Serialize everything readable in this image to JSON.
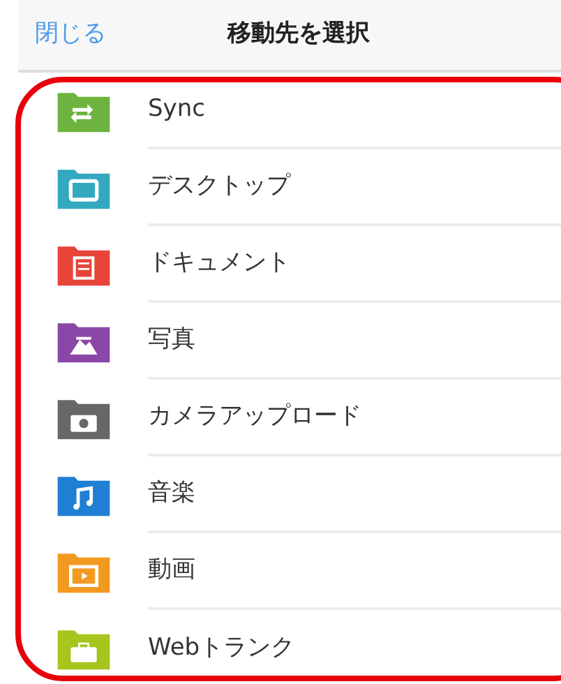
{
  "header": {
    "close": "閉じる",
    "title": "移動先を選択"
  },
  "folders": [
    {
      "name": "Sync",
      "kind": "sync",
      "color": "#6cb43f"
    },
    {
      "name": "デスクトップ",
      "kind": "desktop",
      "color": "#33a9bf"
    },
    {
      "name": "ドキュメント",
      "kind": "document",
      "color": "#e8443a"
    },
    {
      "name": "写真",
      "kind": "photo",
      "color": "#8a47a8"
    },
    {
      "name": "カメラアップロード",
      "kind": "camera",
      "color": "#676767"
    },
    {
      "name": "音楽",
      "kind": "music",
      "color": "#1f7fd4"
    },
    {
      "name": "動画",
      "kind": "video",
      "color": "#f29a1f"
    },
    {
      "name": "Webトランク",
      "kind": "briefcase",
      "color": "#a6c51d"
    }
  ]
}
